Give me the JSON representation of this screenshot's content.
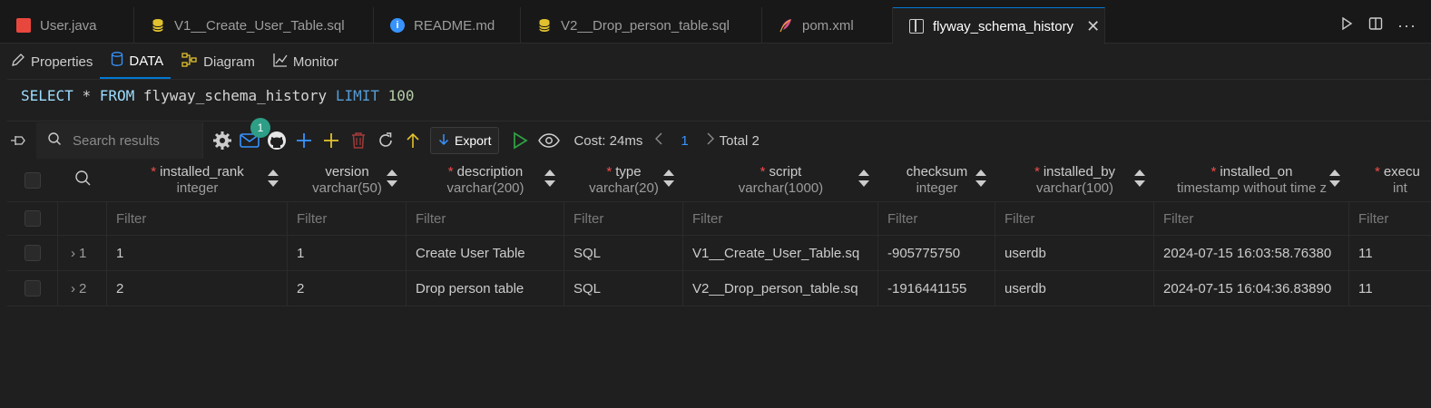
{
  "tabs": [
    {
      "label": "User.java",
      "icon": "java-icon"
    },
    {
      "label": "V1__Create_User_Table.sql",
      "icon": "database-icon"
    },
    {
      "label": "README.md",
      "icon": "info-icon"
    },
    {
      "label": "V2__Drop_person_table.sql",
      "icon": "database-icon"
    },
    {
      "label": "pom.xml",
      "icon": "feather-icon"
    },
    {
      "label": "flyway_schema_history",
      "icon": "table-icon",
      "active": true
    }
  ],
  "subtabs": [
    {
      "label": "Properties",
      "icon": "pencil-icon"
    },
    {
      "label": "DATA",
      "icon": "database-icon",
      "active": true
    },
    {
      "label": "Diagram",
      "icon": "diagram-icon"
    },
    {
      "label": "Monitor",
      "icon": "chart-icon"
    }
  ],
  "query": {
    "select": "SELECT",
    "star": "*",
    "from": "FROM",
    "table": "flyway_schema_history",
    "limit": "LIMIT",
    "limit_value": "100"
  },
  "toolbar": {
    "search_placeholder": "Search results",
    "badge_count": "1",
    "export_label": "Export",
    "cost": "Cost: 24ms",
    "page": "1",
    "total": "Total 2"
  },
  "columns": [
    {
      "name": "installed_rank",
      "type": "integer",
      "required": true
    },
    {
      "name": "version",
      "type": "varchar(50)",
      "required": false
    },
    {
      "name": "description",
      "type": "varchar(200)",
      "required": true
    },
    {
      "name": "type",
      "type": "varchar(20)",
      "required": true
    },
    {
      "name": "script",
      "type": "varchar(1000)",
      "required": true
    },
    {
      "name": "checksum",
      "type": "integer",
      "required": false
    },
    {
      "name": "installed_by",
      "type": "varchar(100)",
      "required": true
    },
    {
      "name": "installed_on",
      "type": "timestamp without time z",
      "required": true
    },
    {
      "name": "execu",
      "type": "int",
      "required": true
    }
  ],
  "filter_placeholder": "Filter",
  "rows": [
    {
      "num": "1",
      "cells": [
        "1",
        "1",
        "Create User Table",
        "SQL",
        "V1__Create_User_Table.sq",
        "-905775750",
        "userdb",
        "2024-07-15 16:03:58.76380",
        "11"
      ]
    },
    {
      "num": "2",
      "cells": [
        "2",
        "2",
        "Drop person table",
        "SQL",
        "V2__Drop_person_table.sq",
        "-1916441155",
        "userdb",
        "2024-07-15 16:04:36.83890",
        "11"
      ]
    }
  ],
  "colors": {
    "accent": "#0078d4",
    "badge": "#2e9e86",
    "required": "#f14c4c"
  }
}
